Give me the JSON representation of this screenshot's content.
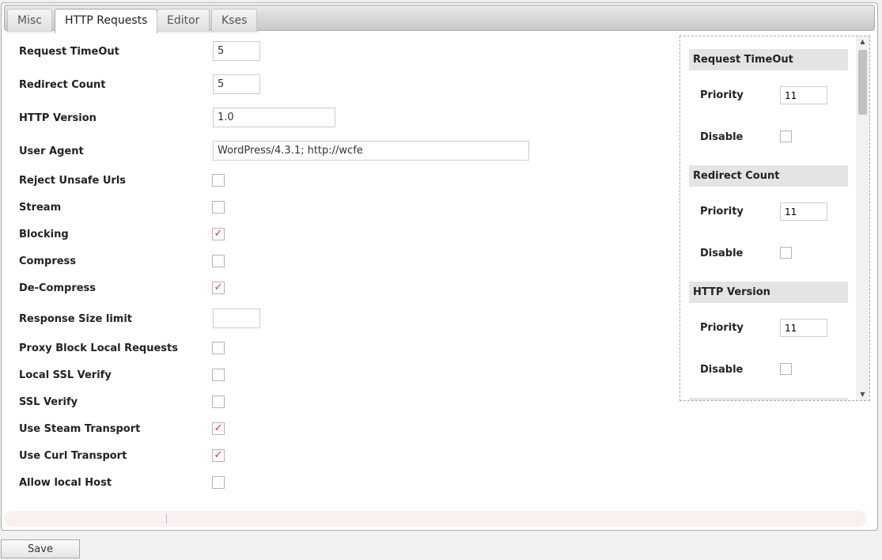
{
  "tabs": [
    "Misc",
    "HTTP Requests",
    "Editor",
    "Kses"
  ],
  "active_tab": "HTTP Requests",
  "fields": {
    "request_timeout": {
      "label": "Request TimeOut",
      "value": "5"
    },
    "redirect_count": {
      "label": "Redirect Count",
      "value": "5"
    },
    "http_version": {
      "label": "HTTP Version",
      "value": "1.0"
    },
    "user_agent": {
      "label": "User Agent",
      "value": "WordPress/4.3.1; http://wcfe"
    },
    "reject_unsafe_urls": {
      "label": "Reject Unsafe Urls",
      "checked": false
    },
    "stream": {
      "label": "Stream",
      "checked": false
    },
    "blocking": {
      "label": "Blocking",
      "checked": true
    },
    "compress": {
      "label": "Compress",
      "checked": false
    },
    "decompress": {
      "label": "De-Compress",
      "checked": true
    },
    "response_size_limit": {
      "label": "Response Size limit",
      "value": ""
    },
    "proxy_block_local": {
      "label": "Proxy Block Local Requests",
      "checked": false
    },
    "local_ssl_verify": {
      "label": "Local SSL Verify",
      "checked": false
    },
    "ssl_verify": {
      "label": "SSL Verify",
      "checked": false
    },
    "use_steam_transport": {
      "label": "Use Steam Transport",
      "checked": true
    },
    "use_curl_transport": {
      "label": "Use Curl Transport",
      "checked": true
    },
    "allow_local_host": {
      "label": "Allow local Host",
      "checked": false
    }
  },
  "priority_panel": {
    "sections": [
      {
        "title": "Request TimeOut",
        "priority_label": "Priority",
        "priority": "11",
        "disable_label": "Disable",
        "disabled": false
      },
      {
        "title": "Redirect Count",
        "priority_label": "Priority",
        "priority": "11",
        "disable_label": "Disable",
        "disabled": false
      },
      {
        "title": "HTTP Version",
        "priority_label": "Priority",
        "priority": "11",
        "disable_label": "Disable",
        "disabled": false
      }
    ]
  },
  "save_label": "Save",
  "colors": {
    "check": "#d63638",
    "accent_bg": "#e4e4e4"
  }
}
